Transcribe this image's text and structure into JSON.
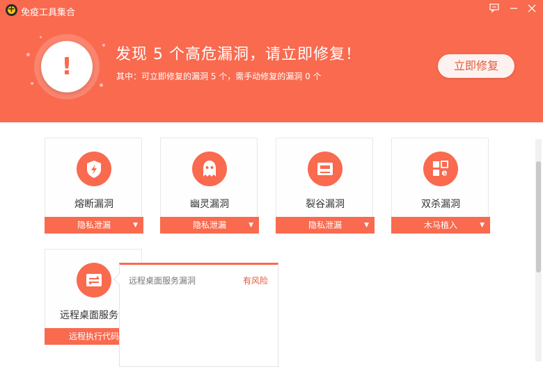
{
  "window": {
    "title": "免疫工具集合",
    "controls": [
      "feedback-icon",
      "minimize-icon",
      "close-icon"
    ]
  },
  "alert": {
    "icon": "exclamation-icon",
    "headline": "发现 5 个高危漏洞，请立即修复！",
    "summary": "其中：可立即修复的漏洞 5 个，需手动修复的漏洞 0 个",
    "fix_button": "立即修复"
  },
  "colors": {
    "accent": "#f96a4f",
    "header_bg": "#f96a4f",
    "risk_text": "#e4553a"
  },
  "vulnerabilities": [
    {
      "name": "熔断漏洞",
      "category": "隐私泄漏",
      "icon": "shield-bolt-icon"
    },
    {
      "name": "幽灵漏洞",
      "category": "隐私泄漏",
      "icon": "ghost-icon"
    },
    {
      "name": "裂谷漏洞",
      "category": "隐私泄漏",
      "icon": "card-icon"
    },
    {
      "name": "双杀漏洞",
      "category": "木马植入",
      "icon": "ie-grid-icon"
    },
    {
      "name": "远程桌面服务漏",
      "category": "远程执行代码",
      "icon": "transfer-icon"
    }
  ],
  "popup": {
    "name": "远程桌面服务漏洞",
    "risk": "有风险"
  }
}
